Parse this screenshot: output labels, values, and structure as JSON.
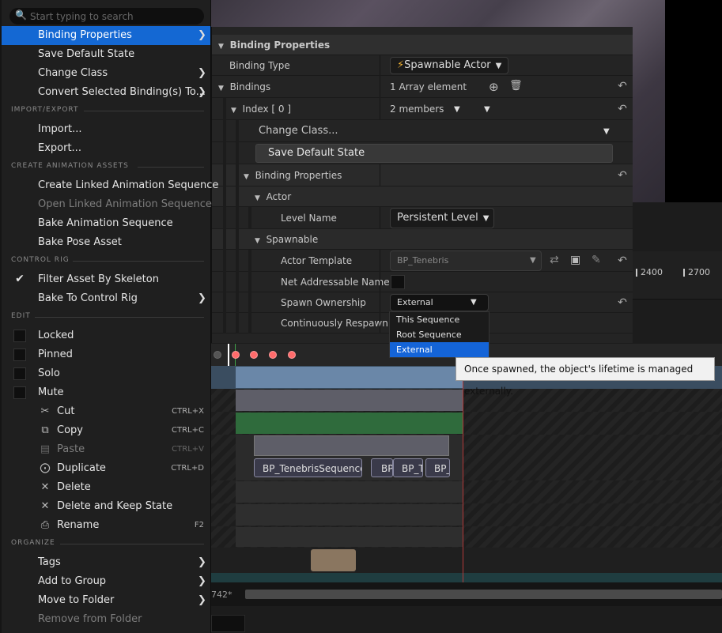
{
  "colors": {
    "accent": "#1468d3",
    "tooltip_bg": "#f1f1f1",
    "key": "#ff6b6b"
  },
  "menu": {
    "search_placeholder": "Start typing to search",
    "items_top": [
      {
        "label": "Binding Properties",
        "submenu": true,
        "highlighted": true
      },
      {
        "label": "Save Default State"
      },
      {
        "label": "Change Class",
        "submenu": true
      },
      {
        "label": "Convert Selected Binding(s) To...",
        "submenu": true
      }
    ],
    "sections": {
      "import_export": "IMPORT/EXPORT",
      "create_anim": "CREATE ANIMATION ASSETS",
      "control_rig": "CONTROL RIG",
      "edit": "EDIT",
      "organize": "ORGANIZE"
    },
    "import": "Import...",
    "export": "Export...",
    "create_linked": "Create Linked Animation Sequence",
    "open_linked": "Open Linked Animation Sequence",
    "bake_anim": "Bake Animation Sequence",
    "bake_pose": "Bake Pose Asset",
    "filter_skeleton": "Filter Asset By Skeleton",
    "bake_control_rig": "Bake To Control Rig",
    "locked": "Locked",
    "pinned": "Pinned",
    "solo": "Solo",
    "mute": "Mute",
    "cut": "Cut",
    "cut_sc": "CTRL+X",
    "copy": "Copy",
    "copy_sc": "CTRL+C",
    "paste": "Paste",
    "paste_sc": "CTRL+V",
    "duplicate": "Duplicate",
    "duplicate_sc": "CTRL+D",
    "delete": "Delete",
    "delete_keep": "Delete and Keep State",
    "rename": "Rename",
    "rename_sc": "F2",
    "tags": "Tags",
    "add_group": "Add to Group",
    "move_folder": "Move to Folder",
    "remove_folder": "Remove from Folder"
  },
  "details": {
    "header": "Binding Properties",
    "binding_type_label": "Binding Type",
    "binding_type_value": "Spawnable Actor",
    "bindings_label": "Bindings",
    "bindings_value": "1 Array element",
    "index_label": "Index [ 0 ]",
    "index_value": "2 members",
    "change_class": "Change Class...",
    "save_default_state": "Save Default State",
    "binding_props_sub": "Binding Properties",
    "actor_section": "Actor",
    "level_name_label": "Level Name",
    "level_name_value": "Persistent Level",
    "spawnable_section": "Spawnable",
    "actor_template_label": "Actor Template",
    "actor_template_value": "BP_Tenebris",
    "net_addressable_label": "Net Addressable Name",
    "spawn_ownership_label": "Spawn Ownership",
    "spawn_ownership_value": "External",
    "continuously_respawn_label": "Continuously Respawn",
    "ownership_options": [
      "This Sequence",
      "Root Sequence",
      "External"
    ],
    "tooltip": "Once spawned, the object's lifetime is managed externally."
  },
  "timeline": {
    "ticks": [
      "2400",
      "2700"
    ],
    "sections": [
      "BP_TenebrisSequence",
      "BP_",
      "BP_T",
      "BP_"
    ],
    "frame_label": "742*"
  }
}
